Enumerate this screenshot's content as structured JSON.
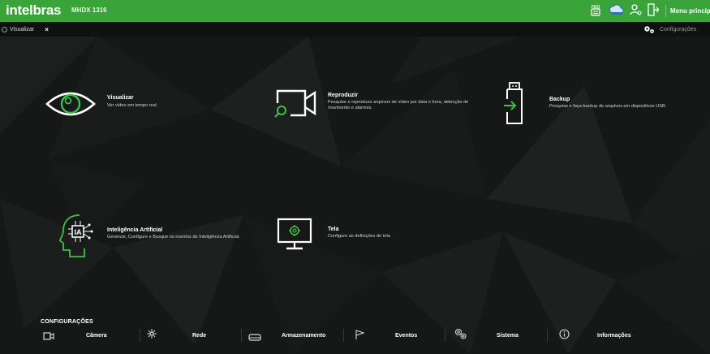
{
  "header": {
    "logo": "intelbras",
    "model": "MHDX 1316",
    "menu_label": "Menu principal",
    "icons": [
      "faq-icon",
      "cloud-icon",
      "user-icon",
      "logout-icon"
    ]
  },
  "tabs": [
    {
      "label": "Visualizar",
      "close": "×"
    }
  ],
  "config_link": {
    "label": "Configurações",
    "icon": "gears-icon"
  },
  "tiles": [
    {
      "title": "Visualizar",
      "desc": "Ver vídeo em tempo real",
      "icon": "eye-icon"
    },
    {
      "title": "Reproduzir",
      "desc": "Pesquise e reproduza arquivos de vídeo por data e hora, detecção de movimento e alarmes.",
      "icon": "playback-camera-search-icon"
    },
    {
      "title": "Backup",
      "desc": "Pesquise e faça backup de arquivos em dispositivos USB.",
      "icon": "usb-backup-icon"
    },
    {
      "title": "Inteligência Artificial",
      "desc": "Gerencie, Configure e Busque os eventos de Inteligência Artificial.",
      "icon": "ai-head-icon"
    },
    {
      "title": "Tela",
      "desc": "Configure as definições de tela",
      "icon": "monitor-settings-icon"
    }
  ],
  "settings": {
    "heading": "CONFIGURAÇÕES",
    "items": [
      {
        "label": "Câmera",
        "icon": "camera-icon"
      },
      {
        "label": "Rede",
        "icon": "network-icon"
      },
      {
        "label": "Armazenamento",
        "icon": "storage-icon"
      },
      {
        "label": "Eventos",
        "icon": "flag-icon"
      },
      {
        "label": "Sistema",
        "icon": "system-gears-icon"
      },
      {
        "label": "Informações",
        "icon": "info-icon"
      }
    ]
  },
  "colors": {
    "brand_green": "#3aa43b",
    "icon_green": "#3fbf4a",
    "background": "#151716"
  }
}
